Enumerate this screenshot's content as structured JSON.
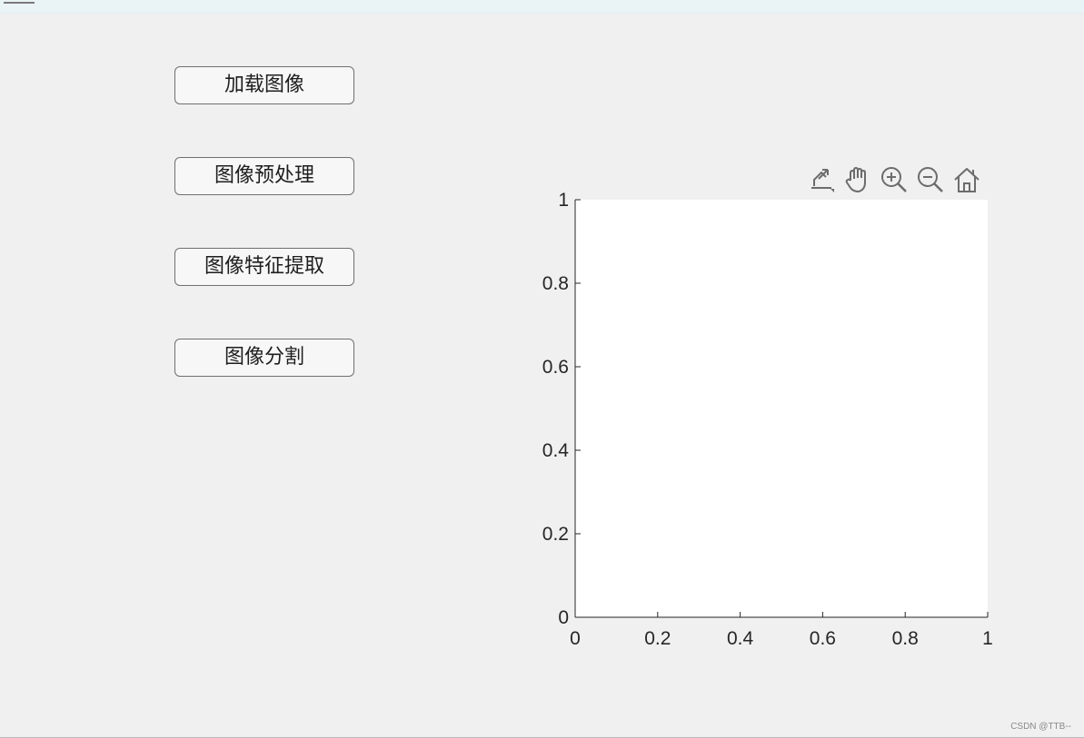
{
  "window": {
    "title_bar_icon": "menu-icon"
  },
  "buttons": [
    {
      "label": "加载图像"
    },
    {
      "label": "图像预处理"
    },
    {
      "label": "图像特征提取"
    },
    {
      "label": "图像分割"
    }
  ],
  "axes_toolbar": {
    "tools": [
      {
        "name": "export-icon"
      },
      {
        "name": "pan-hand-icon"
      },
      {
        "name": "zoom-in-icon"
      },
      {
        "name": "zoom-out-icon"
      },
      {
        "name": "home-icon"
      }
    ]
  },
  "chart_data": {
    "type": "line",
    "title": "",
    "xlabel": "",
    "ylabel": "",
    "xlim": [
      0,
      1
    ],
    "ylim": [
      0,
      1
    ],
    "xticks": [
      0,
      0.2,
      0.4,
      0.6,
      0.8,
      1
    ],
    "yticks": [
      0,
      0.2,
      0.4,
      0.6,
      0.8,
      1
    ],
    "xtick_labels": [
      "0",
      "0.2",
      "0.4",
      "0.6",
      "0.8",
      "1"
    ],
    "ytick_labels": [
      "0",
      "0.2",
      "0.4",
      "0.6",
      "0.8",
      "1"
    ],
    "grid": false,
    "series": [],
    "colors": {
      "plot_background": "#ffffff",
      "axis": "#262626"
    }
  },
  "watermark": "CSDN @TTB--"
}
